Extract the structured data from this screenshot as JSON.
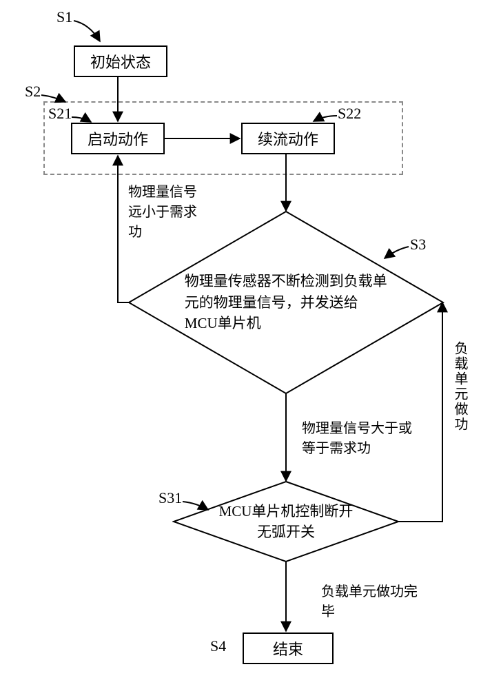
{
  "labels": {
    "s1": "S1",
    "s2": "S2",
    "s21": "S21",
    "s22": "S22",
    "s3": "S3",
    "s31": "S31",
    "s4": "S4"
  },
  "nodes": {
    "initial": "初始状态",
    "start_action": "启动动作",
    "freewheel_action": "续流动作",
    "sensor_decision": "物理量传感器不断检测到负载单元的物理量信号，并发送给MCU单片机",
    "mcu_decision": "MCU单片机控制断开无弧开关",
    "end": "结束"
  },
  "edges": {
    "left_feedback": "物理量信号远小于需求功",
    "sensor_to_mcu": "物理量信号大于或等于需求功",
    "right_loop": "负载单元做功",
    "mcu_to_end": "负载单元做功完毕"
  }
}
